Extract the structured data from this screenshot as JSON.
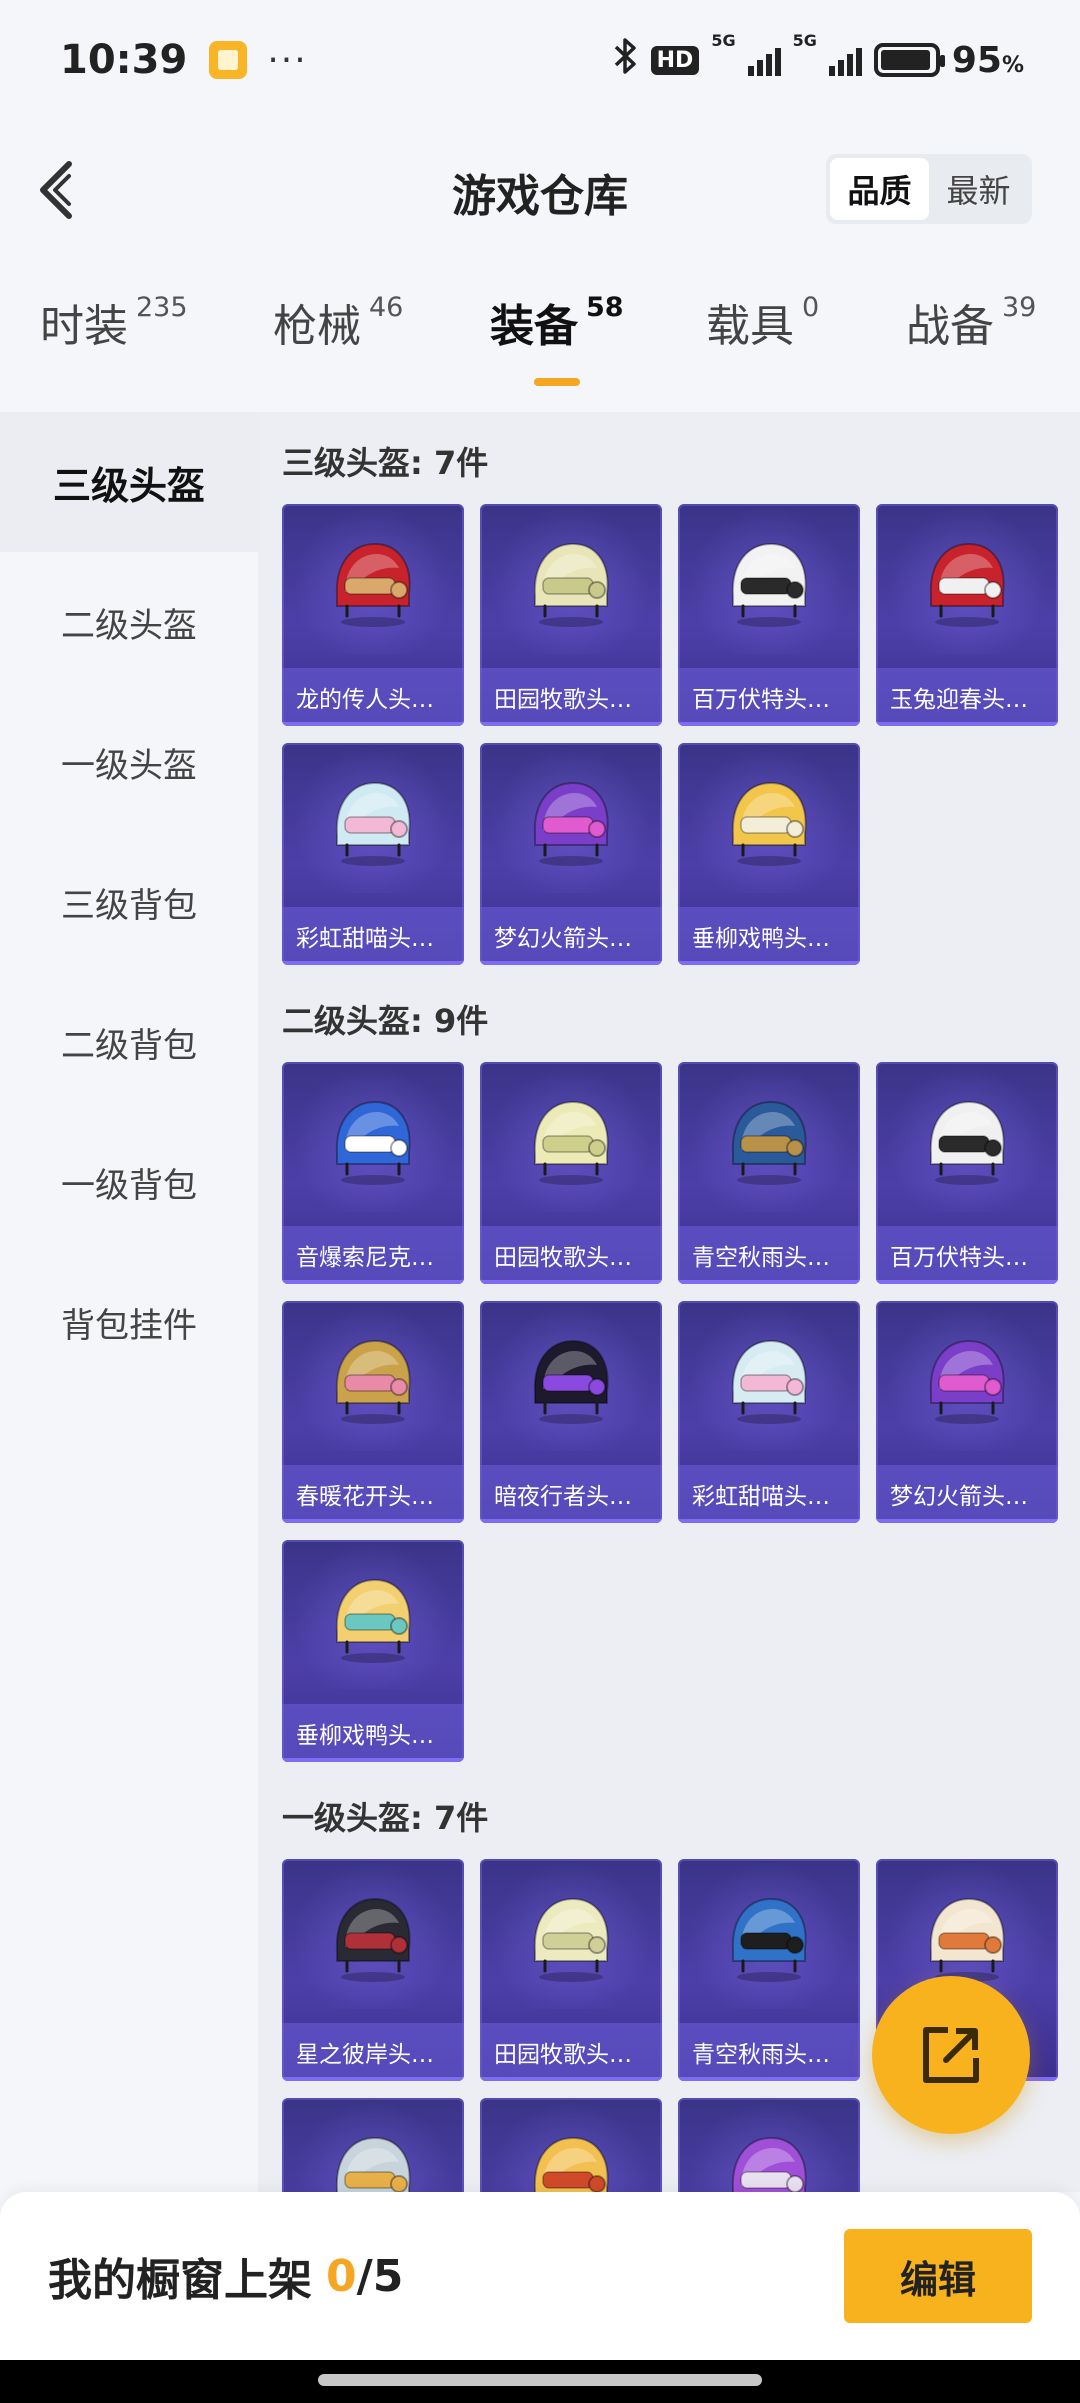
{
  "status_bar": {
    "time": "10:39",
    "dots": "···",
    "hd": "HD",
    "net1": "5G",
    "net2": "5G",
    "battery_level": 0.95,
    "battery_text": "95",
    "battery_unit": "%",
    "icons": [
      "app-notification-icon",
      "bluetooth-icon",
      "hd-icon",
      "signal-5g-icon",
      "signal-5g-icon",
      "battery-icon"
    ]
  },
  "header": {
    "title": "游戏仓库",
    "sort_options": [
      "品质",
      "最新"
    ],
    "active_sort": "品质"
  },
  "tabs": [
    {
      "label": "时装",
      "count": "235"
    },
    {
      "label": "枪械",
      "count": "46"
    },
    {
      "label": "装备",
      "count": "58"
    },
    {
      "label": "载具",
      "count": "0"
    },
    {
      "label": "战备",
      "count": "39"
    }
  ],
  "active_tab": "装备",
  "sidebar": {
    "items": [
      "三级头盔",
      "二级头盔",
      "一级头盔",
      "三级背包",
      "二级背包",
      "一级背包",
      "背包挂件"
    ],
    "active": "三级头盔"
  },
  "sections": [
    {
      "title": "三级头盔: 7件",
      "items": [
        {
          "name": "龙的传人头…",
          "colors": [
            "#c8232c",
            "#d9a86a"
          ]
        },
        {
          "name": "田园牧歌头…",
          "colors": [
            "#e8e6b8",
            "#c9c98a"
          ]
        },
        {
          "name": "百万伏特头…",
          "colors": [
            "#f2f2f2",
            "#2a2a2a"
          ]
        },
        {
          "name": "玉兔迎春头…",
          "colors": [
            "#c8232c",
            "#f0f0f0"
          ]
        },
        {
          "name": "彩虹甜喵头…",
          "colors": [
            "#cfeaf2",
            "#f3b8d6"
          ]
        },
        {
          "name": "梦幻火箭头…",
          "colors": [
            "#7a3ec8",
            "#e05ad0"
          ]
        },
        {
          "name": "垂柳戏鸭头…",
          "colors": [
            "#f2c64a",
            "#f3eed8"
          ]
        }
      ]
    },
    {
      "title": "二级头盔: 9件",
      "items": [
        {
          "name": "音爆索尼克…",
          "colors": [
            "#2f66d8",
            "#ffffff"
          ]
        },
        {
          "name": "田园牧歌头…",
          "colors": [
            "#ecebb8",
            "#cfcf8c"
          ]
        },
        {
          "name": "青空秋雨头…",
          "colors": [
            "#2a5a9a",
            "#b8914a"
          ]
        },
        {
          "name": "百万伏特头…",
          "colors": [
            "#f0f0f0",
            "#2a2a2a"
          ]
        },
        {
          "name": "春暖花开头…",
          "colors": [
            "#c9a24a",
            "#e88aa8"
          ]
        },
        {
          "name": "暗夜行者头…",
          "colors": [
            "#1e1a2e",
            "#8a4ae0"
          ]
        },
        {
          "name": "彩虹甜喵头…",
          "colors": [
            "#d6ecf2",
            "#f3b8d6"
          ]
        },
        {
          "name": "梦幻火箭头…",
          "colors": [
            "#7a3ec8",
            "#e05ad0"
          ]
        },
        {
          "name": "垂柳戏鸭头…",
          "colors": [
            "#f2d070",
            "#6ac8c0"
          ]
        }
      ]
    },
    {
      "title": "一级头盔: 7件",
      "items": [
        {
          "name": "星之彼岸头…",
          "colors": [
            "#2a2a34",
            "#b0303a"
          ]
        },
        {
          "name": "田园牧歌头…",
          "colors": [
            "#ecebc0",
            "#d0cf98"
          ]
        },
        {
          "name": "青空秋雨头…",
          "colors": [
            "#2f72c8",
            "#1e1e1e"
          ]
        },
        {
          "name": "",
          "colors": [
            "#f3e6d0",
            "#e07a3a"
          ]
        },
        {
          "name": "",
          "colors": [
            "#c8d4dc",
            "#e8b04a"
          ]
        },
        {
          "name": "",
          "colors": [
            "#f2c050",
            "#d04a2a"
          ]
        },
        {
          "name": "",
          "colors": [
            "#a050d8",
            "#e8e0f0"
          ]
        }
      ]
    }
  ],
  "fab": {
    "icon": "share-external-icon"
  },
  "bottom_bar": {
    "label": "我的橱窗上架",
    "current": "0",
    "separator": "/",
    "total": "5",
    "edit_label": "编辑"
  }
}
